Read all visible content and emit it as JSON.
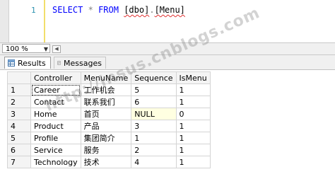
{
  "editor": {
    "line_number": "1",
    "code": {
      "kw_select": "SELECT",
      "op_star": "*",
      "kw_from": "FROM",
      "schema": "[dbo]",
      "dot": ".",
      "table": "[Menu]"
    }
  },
  "zoom": {
    "value": "100 %"
  },
  "tabs": {
    "results": "Results",
    "messages": "Messages"
  },
  "grid": {
    "columns": [
      "Controller",
      "MenuName",
      "Sequence",
      "IsMenu"
    ],
    "rows": [
      {
        "rownum": "1",
        "controller": "Career",
        "menuname": "工作机会",
        "sequence": "5",
        "ismenu": "1"
      },
      {
        "rownum": "2",
        "controller": "Contact",
        "menuname": "联系我们",
        "sequence": "6",
        "ismenu": "1"
      },
      {
        "rownum": "3",
        "controller": "Home",
        "menuname": "首页",
        "sequence": "NULL",
        "ismenu": "0"
      },
      {
        "rownum": "4",
        "controller": "Product",
        "menuname": "产品",
        "sequence": "3",
        "ismenu": "1"
      },
      {
        "rownum": "5",
        "controller": "Profile",
        "menuname": "集团简介",
        "sequence": "1",
        "ismenu": "1"
      },
      {
        "rownum": "6",
        "controller": "Service",
        "menuname": "服务",
        "sequence": "2",
        "ismenu": "1"
      },
      {
        "rownum": "7",
        "controller": "Technology",
        "menuname": "技术",
        "sequence": "4",
        "ismenu": "1"
      }
    ]
  },
  "watermark": "http://insus.cnblogs.com",
  "colors": {
    "keyword": "#0000ff",
    "null_cell": "#ffffe1",
    "line_number": "#2b91af"
  }
}
